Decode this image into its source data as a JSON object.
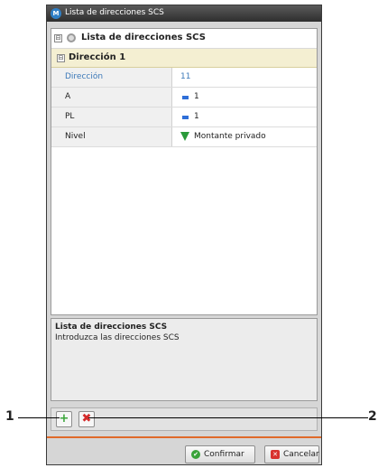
{
  "window": {
    "title": "Lista de direcciones SCS"
  },
  "grid": {
    "root": {
      "label": "Lista de direcciones SCS",
      "toggle": "⊟"
    },
    "section": {
      "label": "Dirección 1",
      "toggle": "⊟"
    },
    "rows": [
      {
        "name": "Dirección",
        "value": "11"
      },
      {
        "name": "A",
        "value": "1",
        "icon": "bar-icon"
      },
      {
        "name": "PL",
        "value": "1",
        "icon": "bar-icon"
      },
      {
        "name": "Nivel",
        "value": "Montante privado",
        "icon": "gem-icon"
      }
    ]
  },
  "description": {
    "title": "Lista de direcciones SCS",
    "text": "Introduzca las direcciones SCS"
  },
  "toolbar": {
    "add_icon": "plus-icon",
    "delete_icon": "x-icon"
  },
  "buttons": {
    "confirm": "Confirmar",
    "cancel": "Cancelar"
  },
  "callouts": [
    "1",
    "2"
  ],
  "colors": {
    "accent": "#e06a2a",
    "title_bar": "#2e2e2e",
    "section": "#f4efd2",
    "link": "#3b78b8"
  }
}
